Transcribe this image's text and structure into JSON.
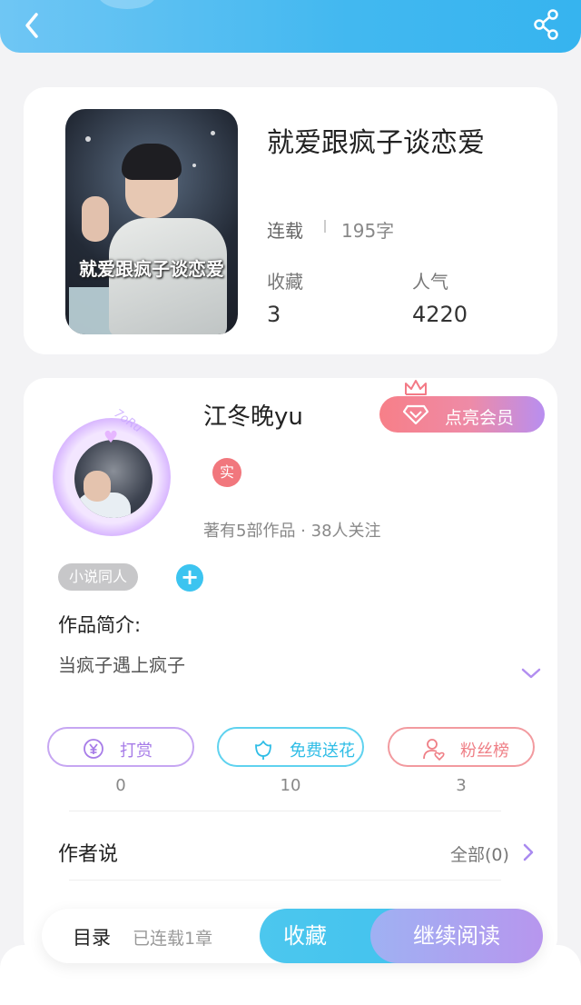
{
  "header": {
    "back_icon": "chevron-left-icon",
    "share_icon": "share-icon",
    "colors": {
      "gradient_start": "#6fc6f4",
      "gradient_end": "#36b4ef"
    }
  },
  "book": {
    "title": "就爱跟疯子谈恋爱",
    "cover_text": "就爱跟疯子谈恋爱",
    "status": "连载",
    "word_count": "195字",
    "stats": [
      {
        "label": "收藏",
        "value": "3"
      },
      {
        "label": "人气",
        "value": "4220"
      }
    ]
  },
  "author": {
    "name": "江冬晚yu",
    "frame_text": "7oRu",
    "vip_label": "点亮会员",
    "verified_badge": "实",
    "meta": "著有5部作品 · 38人关注",
    "tag": "小说同人",
    "add_tag": "+"
  },
  "intro": {
    "heading": "作品简介:",
    "text": "当疯子遇上疯子"
  },
  "actions": [
    {
      "label": "打赏",
      "count": "0",
      "icon": "yen-coin-icon",
      "color": "#a77ce8"
    },
    {
      "label": "免费送花",
      "count": "10",
      "icon": "flower-icon",
      "color": "#2fbde6"
    },
    {
      "label": "粉丝榜",
      "count": "3",
      "icon": "user-heart-icon",
      "color": "#ef7f86"
    }
  ],
  "author_say": {
    "title": "作者说",
    "all_label": "全部(0)"
  },
  "bottom_bar": {
    "toc": "目录",
    "serial_info": "已连载1章",
    "collect": "收藏",
    "continue_read": "继续阅读"
  }
}
